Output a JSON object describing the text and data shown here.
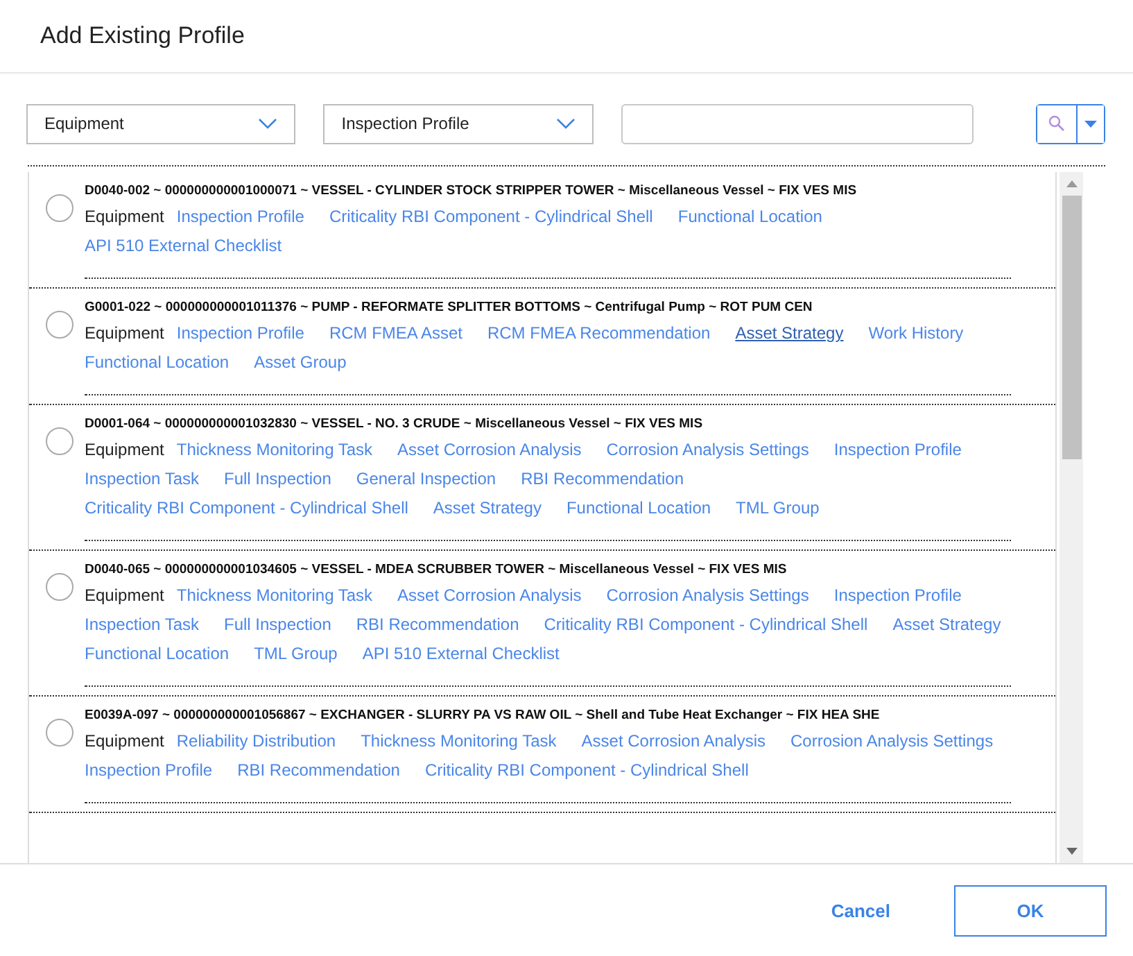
{
  "dialog": {
    "title": "Add Existing Profile"
  },
  "filters": {
    "family": {
      "value": "Equipment"
    },
    "profile": {
      "value": "Inspection Profile"
    }
  },
  "results": [
    {
      "selected": false,
      "heading": "D0040-002 ~ 000000000001000071 ~ VESSEL - CYLINDER STOCK STRIPPER TOWER ~ Miscellaneous Vessel ~ FIX VES MIS",
      "type": "Equipment",
      "links": [
        {
          "label": "Inspection Profile",
          "hovered": false
        },
        {
          "label": "Criticality RBI Component - Cylindrical Shell",
          "hovered": false
        },
        {
          "label": "Functional Location",
          "hovered": false
        },
        {
          "label": "API 510 External Checklist",
          "hovered": false
        }
      ]
    },
    {
      "selected": false,
      "heading": "G0001-022 ~ 000000000001011376 ~ PUMP - REFORMATE SPLITTER BOTTOMS ~ Centrifugal Pump ~ ROT PUM CEN",
      "type": "Equipment",
      "links": [
        {
          "label": "Inspection Profile",
          "hovered": false
        },
        {
          "label": "RCM FMEA Asset",
          "hovered": false
        },
        {
          "label": "RCM FMEA Recommendation",
          "hovered": false
        },
        {
          "label": "Asset Strategy",
          "hovered": true
        },
        {
          "label": "Work History",
          "hovered": false
        },
        {
          "label": "Functional Location",
          "hovered": false
        },
        {
          "label": "Asset Group",
          "hovered": false
        }
      ]
    },
    {
      "selected": false,
      "heading": "D0001-064 ~ 000000000001032830 ~ VESSEL - NO. 3 CRUDE ~ Miscellaneous Vessel ~ FIX VES MIS",
      "type": "Equipment",
      "links": [
        {
          "label": "Thickness Monitoring Task",
          "hovered": false
        },
        {
          "label": "Asset Corrosion Analysis",
          "hovered": false
        },
        {
          "label": "Corrosion Analysis Settings",
          "hovered": false
        },
        {
          "label": "Inspection Profile",
          "hovered": false
        },
        {
          "label": "Inspection Task",
          "hovered": false
        },
        {
          "label": "Full Inspection",
          "hovered": false
        },
        {
          "label": "General Inspection",
          "hovered": false
        },
        {
          "label": "RBI Recommendation",
          "hovered": false
        },
        {
          "label": "Criticality RBI Component - Cylindrical Shell",
          "hovered": false
        },
        {
          "label": "Asset Strategy",
          "hovered": false
        },
        {
          "label": "Functional Location",
          "hovered": false
        },
        {
          "label": "TML Group",
          "hovered": false
        }
      ]
    },
    {
      "selected": false,
      "heading": "D0040-065 ~ 000000000001034605 ~ VESSEL - MDEA SCRUBBER TOWER ~ Miscellaneous Vessel ~ FIX VES MIS",
      "type": "Equipment",
      "links": [
        {
          "label": "Thickness Monitoring Task",
          "hovered": false
        },
        {
          "label": "Asset Corrosion Analysis",
          "hovered": false
        },
        {
          "label": "Corrosion Analysis Settings",
          "hovered": false
        },
        {
          "label": "Inspection Profile",
          "hovered": false
        },
        {
          "label": "Inspection Task",
          "hovered": false
        },
        {
          "label": "Full Inspection",
          "hovered": false
        },
        {
          "label": "RBI Recommendation",
          "hovered": false
        },
        {
          "label": "Criticality RBI Component - Cylindrical Shell",
          "hovered": false
        },
        {
          "label": "Asset Strategy",
          "hovered": false
        },
        {
          "label": "Functional Location",
          "hovered": false
        },
        {
          "label": "TML Group",
          "hovered": false
        },
        {
          "label": "API 510 External Checklist",
          "hovered": false
        }
      ]
    },
    {
      "selected": false,
      "heading": "E0039A-097 ~ 000000000001056867 ~ EXCHANGER - SLURRY PA VS RAW OIL ~ Shell and Tube Heat Exchanger ~ FIX HEA SHE",
      "type": "Equipment",
      "links": [
        {
          "label": "Reliability Distribution",
          "hovered": false
        },
        {
          "label": "Thickness Monitoring Task",
          "hovered": false
        },
        {
          "label": "Asset Corrosion Analysis",
          "hovered": false
        },
        {
          "label": "Corrosion Analysis Settings",
          "hovered": false
        },
        {
          "label": "Inspection Profile",
          "hovered": false
        },
        {
          "label": "RBI Recommendation",
          "hovered": false
        },
        {
          "label": "Criticality RBI Component - Cylindrical Shell",
          "hovered": false
        }
      ]
    }
  ],
  "buttons": {
    "cancel": "Cancel",
    "ok": "OK"
  }
}
